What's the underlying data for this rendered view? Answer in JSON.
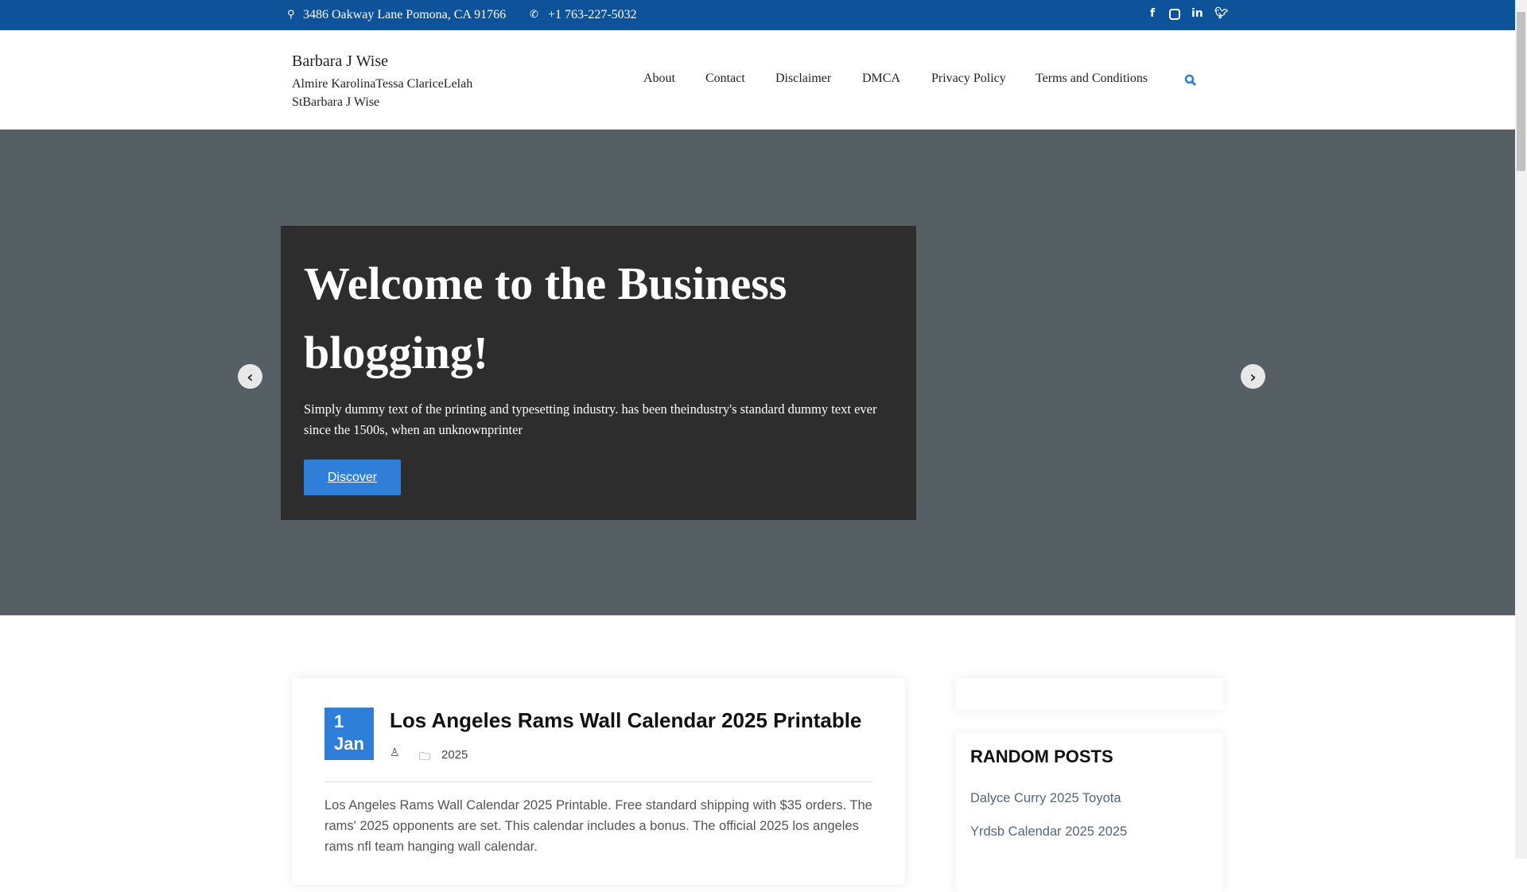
{
  "topbar": {
    "address": "3486 Oakway Lane Pomona, CA 91766",
    "phone": "+1 763-227-5032",
    "social": [
      "facebook",
      "instagram",
      "linkedin",
      "twitter"
    ]
  },
  "header": {
    "site_title": "Barbara J Wise",
    "tagline": "Almire KarolinaTessa ClariceLelah StBarbara J Wise",
    "nav": [
      "About",
      "Contact",
      "Disclaimer",
      "DMCA",
      "Privacy Policy",
      "Terms and Conditions"
    ]
  },
  "hero": {
    "title": "Welcome to the Business blogging!",
    "text": "Simply dummy text of the printing and typesetting industry. has been theindustry's standard dummy text ever since the 1500s, when an unknownprinter",
    "button": "Discover"
  },
  "post": {
    "day": "1",
    "month": "Jan",
    "title": "Los Angeles Rams Wall Calendar 2025 Printable",
    "category": "2025",
    "excerpt": "Los Angeles Rams Wall Calendar 2025 Printable. Free standard shipping with $35 orders. The rams' 2025 opponents are set. This calendar includes a bonus. The official 2025 los angeles rams nfl team hanging wall calendar."
  },
  "sidebar": {
    "random_title": "RANDOM POSTS",
    "random_posts": [
      "Dalyce Curry 2025 Toyota",
      "Yrdsb Calendar 2025 2025"
    ]
  },
  "colors": {
    "topbar": "#0e5299",
    "accent": "#2f7fd8",
    "hero": "#565f63"
  }
}
